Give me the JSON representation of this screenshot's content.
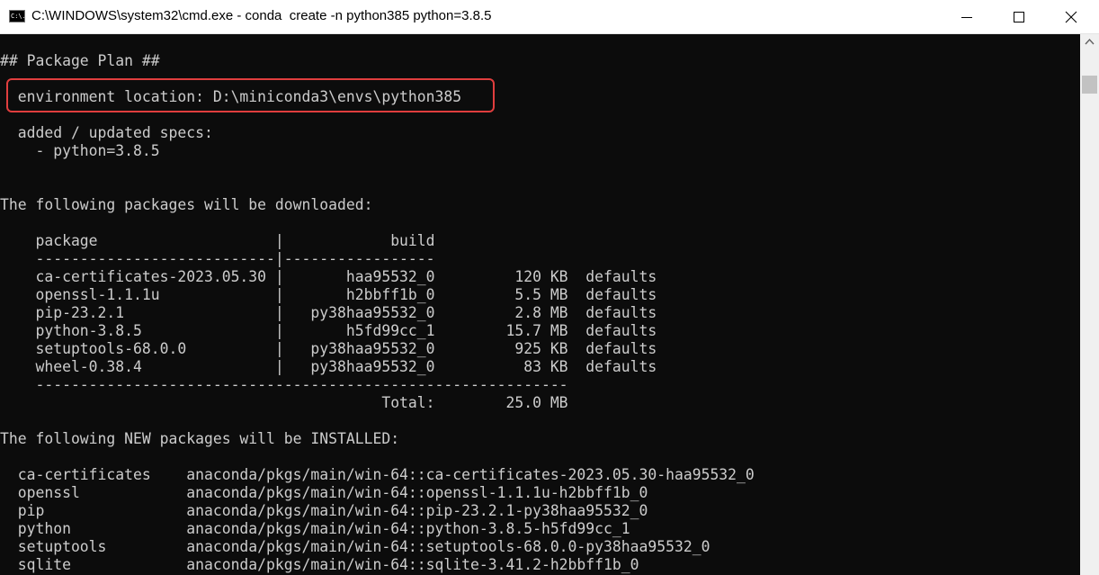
{
  "window": {
    "icon_text": "C:\\.",
    "title": "C:\\WINDOWS\\system32\\cmd.exe - conda  create -n python385 python=3.8.5"
  },
  "console": {
    "lines": [
      "## Package Plan ##",
      "  environment location: D:\\miniconda3\\envs\\python385",
      "  added / updated specs:",
      "    - python=3.8.5",
      "The following packages will be downloaded:",
      "    package                    |            build",
      "    ---------------------------|-----------------",
      "    ca-certificates-2023.05.30 |       haa95532_0         120 KB  defaults",
      "    openssl-1.1.1u             |       h2bbff1b_0         5.5 MB  defaults",
      "    pip-23.2.1                 |   py38haa95532_0         2.8 MB  defaults",
      "    python-3.8.5               |       h5fd99cc_1        15.7 MB  defaults",
      "    setuptools-68.0.0          |   py38haa95532_0         925 KB  defaults",
      "    wheel-0.38.4               |   py38haa95532_0          83 KB  defaults",
      "    ------------------------------------------------------------",
      "                                           Total:        25.0 MB",
      "The following NEW packages will be INSTALLED:",
      "  ca-certificates    anaconda/pkgs/main/win-64::ca-certificates-2023.05.30-haa95532_0",
      "  openssl            anaconda/pkgs/main/win-64::openssl-1.1.1u-h2bbff1b_0",
      "  pip                anaconda/pkgs/main/win-64::pip-23.2.1-py38haa95532_0",
      "  python             anaconda/pkgs/main/win-64::python-3.8.5-h5fd99cc_1",
      "  setuptools         anaconda/pkgs/main/win-64::setuptools-68.0.0-py38haa95532_0",
      "  sqlite             anaconda/pkgs/main/win-64::sqlite-3.41.2-h2bbff1b_0"
    ]
  },
  "colors": {
    "console_background": "#0c0c0c",
    "console_text": "#cccccc",
    "highlight_box": "#e03e3e"
  },
  "icons": {
    "minimize": "minimize-icon",
    "maximize": "maximize-icon",
    "close": "close-icon"
  }
}
